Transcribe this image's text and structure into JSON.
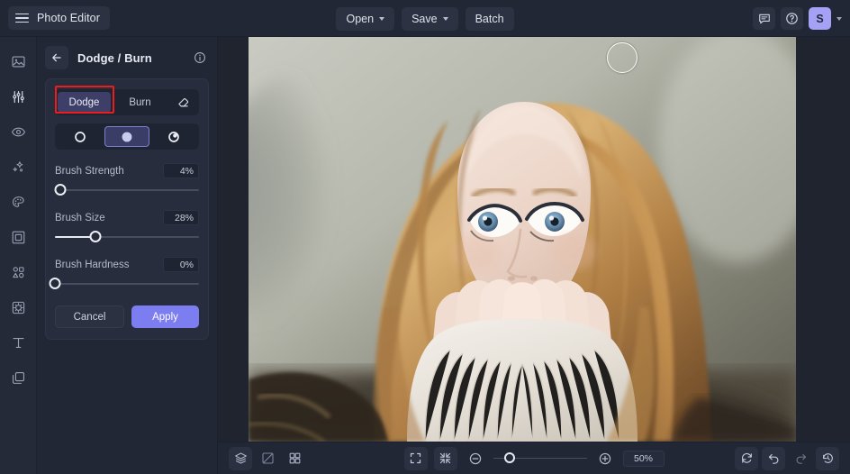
{
  "app": {
    "brand": "Photo Editor",
    "menu_icon": "hamburger-icon"
  },
  "topbar": {
    "open_label": "Open",
    "save_label": "Save",
    "batch_label": "Batch",
    "comment_icon": "comment-icon",
    "help_icon": "help-circle-icon",
    "avatar_initial": "S",
    "avatar_color": "#a5a2f5"
  },
  "rail": {
    "items": [
      {
        "icon": "image-icon",
        "name": "sidebar-item-image"
      },
      {
        "icon": "adjustments-icon",
        "name": "sidebar-item-adjust"
      },
      {
        "icon": "eye-icon",
        "name": "sidebar-item-retouch"
      },
      {
        "icon": "sparkles-icon",
        "name": "sidebar-item-effects"
      },
      {
        "icon": "palette-icon",
        "name": "sidebar-item-color"
      },
      {
        "icon": "frame-icon",
        "name": "sidebar-item-frame"
      },
      {
        "icon": "shapes-icon",
        "name": "sidebar-item-shapes"
      },
      {
        "icon": "sticker-icon",
        "name": "sidebar-item-sticker"
      },
      {
        "icon": "text-icon",
        "name": "sidebar-item-text"
      },
      {
        "icon": "layers-icon",
        "name": "sidebar-item-layers"
      }
    ]
  },
  "panel": {
    "title": "Dodge / Burn",
    "back_icon": "arrow-left-icon",
    "info_icon": "info-circle-icon",
    "modes": [
      {
        "label": "Dodge",
        "active": true
      },
      {
        "label": "Burn",
        "active": false
      }
    ],
    "eraser_icon": "eraser-icon",
    "tones": [
      {
        "icon": "tone-shadows-icon",
        "active": false
      },
      {
        "icon": "tone-midtones-icon",
        "active": true
      },
      {
        "icon": "tone-highlights-icon",
        "active": false
      }
    ],
    "sliders": [
      {
        "label": "Brush Strength",
        "value": "4%",
        "pct": 4
      },
      {
        "label": "Brush Size",
        "value": "28%",
        "pct": 28
      },
      {
        "label": "Brush Hardness",
        "value": "0%",
        "pct": 0
      }
    ],
    "cancel_label": "Cancel",
    "apply_label": "Apply",
    "apply_color": "#7b7df0",
    "highlight_color": "#ef1c1c",
    "highlight_target": "Dodge"
  },
  "canvas": {
    "brush_cursor": "brush-cursor-circle",
    "image_subject": "portrait-photo"
  },
  "bottombar": {
    "left_tools": [
      {
        "icon": "layers-stack-icon",
        "name": "layers-button"
      },
      {
        "icon": "compare-icon",
        "name": "compare-button"
      },
      {
        "icon": "grid-icon",
        "name": "grid-button"
      }
    ],
    "fit_icon": "fit-screen-icon",
    "shrink_icon": "shrink-to-fit-icon",
    "zoom_out_icon": "zoom-out-icon",
    "zoom_in_icon": "zoom-in-icon",
    "zoom_value": "50%",
    "zoom_slider_pct": 18,
    "right_tools": [
      {
        "icon": "reset-icon",
        "name": "reset-button",
        "dim": false
      },
      {
        "icon": "undo-icon",
        "name": "undo-button",
        "dim": false
      },
      {
        "icon": "redo-icon",
        "name": "redo-button",
        "dim": true
      },
      {
        "icon": "history-icon",
        "name": "history-button",
        "dim": false
      }
    ]
  }
}
